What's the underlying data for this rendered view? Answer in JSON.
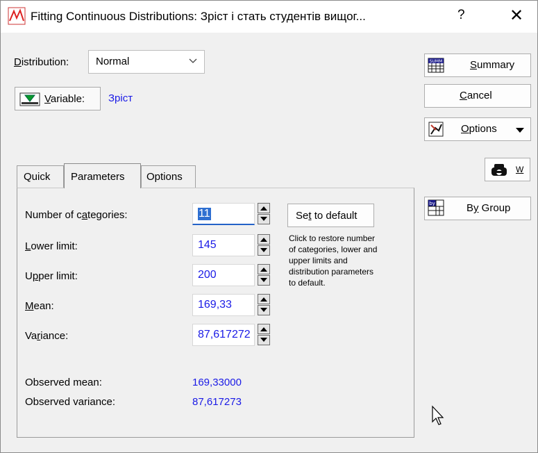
{
  "window": {
    "title": "Fitting Continuous Distributions: Зріст і стать студентів вищог...",
    "help_label": "?",
    "close_label": "✕"
  },
  "distribution": {
    "label_pre": "",
    "label_mn": "D",
    "label_post": "istribution:",
    "value": "Normal"
  },
  "variable": {
    "button_mn": "V",
    "button_post": "ariable:",
    "value": "Зріст"
  },
  "right_buttons": {
    "summary_mn": "S",
    "summary_post": "ummary",
    "cancel_mn": "C",
    "cancel_post": "ancel",
    "options_mn": "O",
    "options_post": "ptions",
    "w_label": "W",
    "bygroup_pre": "B",
    "bygroup_mn": "y",
    "bygroup_post": " Group",
    "summary_icon_text": "SUMM"
  },
  "tabs": [
    {
      "label": "Quick"
    },
    {
      "label": "Parameters"
    },
    {
      "label": "Options"
    }
  ],
  "params": {
    "categories_pre": "Number of c",
    "categories_mn": "a",
    "categories_post": "tegories:",
    "categories_value": "11",
    "lower_mn": "L",
    "lower_post": "ower limit:",
    "lower_value": "145",
    "upper_pre": "U",
    "upper_mn": "p",
    "upper_post": "per limit:",
    "upper_value": "200",
    "mean_mn": "M",
    "mean_post": "ean:",
    "mean_value": "169,33",
    "variance_pre": "Va",
    "variance_mn": "r",
    "variance_post": "iance:",
    "variance_value": "87,617272",
    "set_default_pre": "Se",
    "set_default_mn": "t",
    "set_default_post": " to default",
    "note": "Click to restore number of categories, lower and upper limits and distribution parameters to default.",
    "observed_mean_label": "Observed mean:",
    "observed_mean_value": "169,33000",
    "observed_variance_label": "Observed variance:",
    "observed_variance_value": "87,617273"
  }
}
